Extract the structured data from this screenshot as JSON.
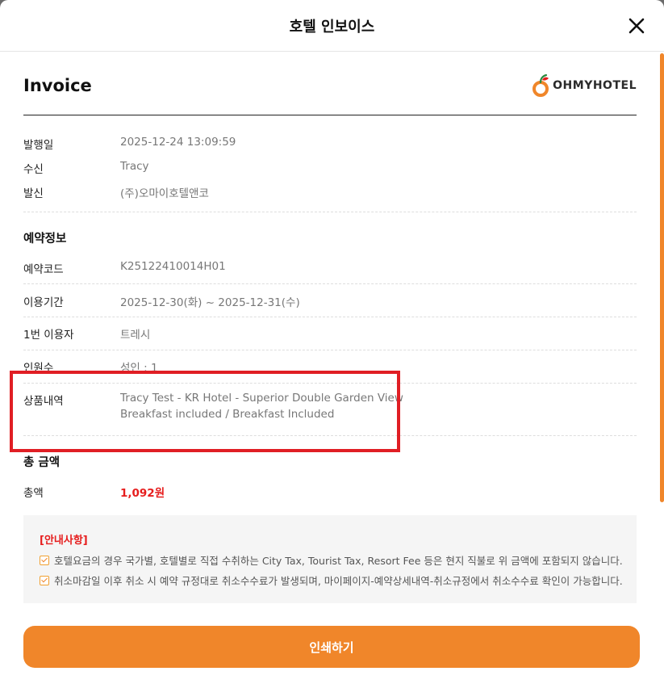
{
  "modal": {
    "title": "호텔 인보이스"
  },
  "invoice": {
    "heading": "Invoice",
    "logo_text": "OHMYHOTEL",
    "issue": [
      {
        "label": "발행일",
        "value": "2025-12-24 13:09:59"
      },
      {
        "label": "수신",
        "value": "Tracy"
      },
      {
        "label": "발신",
        "value": "(주)오마이호텔앤코"
      }
    ]
  },
  "reservation": {
    "section_title": "예약정보",
    "rows": [
      {
        "label": "예약코드",
        "value": "K25122410014H01"
      },
      {
        "label": "이용기간",
        "value": "2025-12-30(화) ~ 2025-12-31(수)"
      },
      {
        "label": "1번 이용자",
        "value": "트레시"
      },
      {
        "label": "인원수",
        "value": "성인 : 1"
      }
    ],
    "product": {
      "label": "상품내역",
      "line1": "Tracy Test - KR Hotel - Superior Double Garden View",
      "line2": "Breakfast included / Breakfast Included"
    }
  },
  "total": {
    "section_title": "총 금액",
    "label": "총액",
    "value": "1,092원"
  },
  "notice": {
    "title": "[안내사항]",
    "items": [
      "호텔요금의 경우 국가별, 호텔별로 직접 수취하는 City Tax, Tourist Tax, Resort Fee 등은 현지 직불로 위 금액에 포함되지 않습니다.",
      "취소마감일 이후 취소 시 예약 규정대로 취소수수료가 발생되며, 마이페이지-예약상세내역-취소규정에서 취소수수료 확인이 가능합니다."
    ]
  },
  "actions": {
    "print_label": "인쇄하기"
  },
  "colors": {
    "accent": "#f0862a",
    "alert": "#e61d1d",
    "highlight": "#e01e24"
  }
}
